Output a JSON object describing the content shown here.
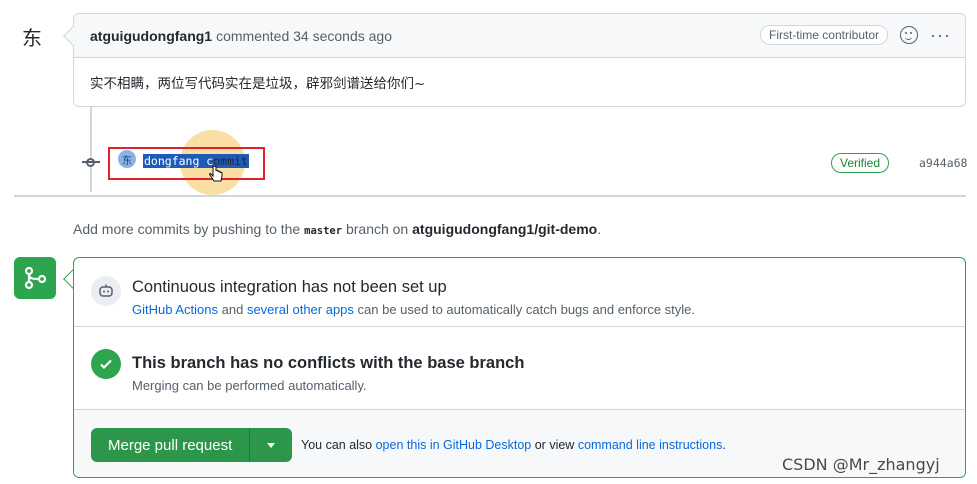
{
  "comment": {
    "avatar_char": "东",
    "author": "atguigudongfang1",
    "meta": "commented 34 seconds ago",
    "badge": "First-time contributor",
    "more_label": "···",
    "body": "实不相瞒，两位写代码实在是垃圾，辟邪剑谱送给你们~"
  },
  "commit": {
    "avatar_char": "东",
    "message_selected": "dongfang c",
    "message_rest": "ommit",
    "verified": "Verified",
    "sha": "a944a68"
  },
  "push_hint": {
    "prefix": "Add more commits by pushing to the",
    "branch": "master",
    "middle": "branch on",
    "repo": "atguigudongfang1/git-demo",
    "suffix": "."
  },
  "ci": {
    "title": "Continuous integration has not been set up",
    "link1": "GitHub Actions",
    "and": "and",
    "link2": "several other apps",
    "rest": "can be used to automatically catch bugs and enforce style."
  },
  "conflicts": {
    "title": "This branch has no conflicts with the base branch",
    "sub": "Merging can be performed automatically."
  },
  "merge": {
    "button": "Merge pull request",
    "also_prefix": "You can also",
    "link_desktop": "open this in GitHub Desktop",
    "or_view": "or view",
    "link_cli": "command line instructions",
    "suffix": "."
  },
  "watermark": "CSDN @Mr_zhangyj",
  "colors": {
    "accent_green": "#2da44e",
    "link_blue": "#0969da",
    "highlight_red": "#e0202a"
  }
}
